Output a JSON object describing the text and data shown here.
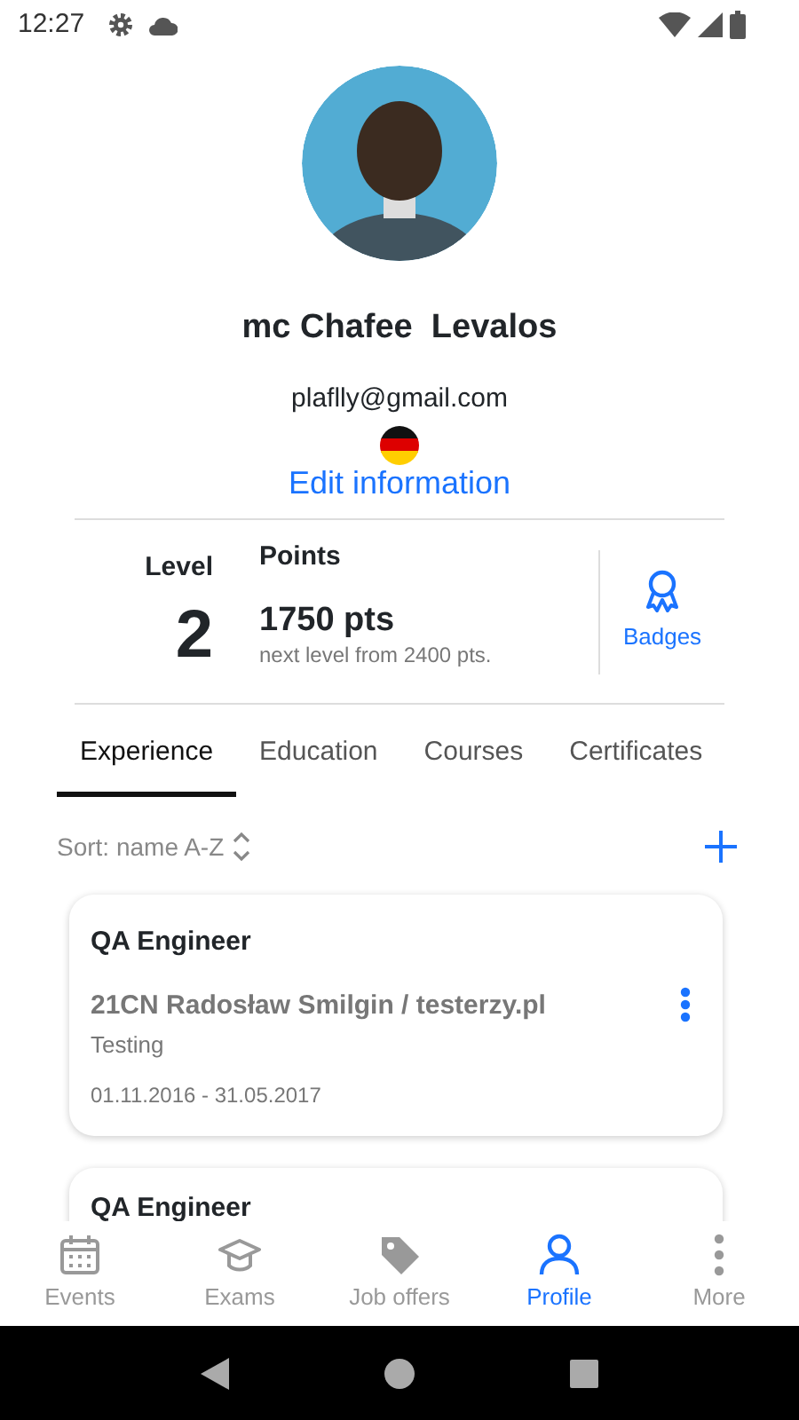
{
  "status_bar": {
    "time": "12:27"
  },
  "profile": {
    "name": "mc Chafee  Levalos",
    "email": "plaflly@gmail.com",
    "edit_link": "Edit information"
  },
  "stats": {
    "level_label": "Level",
    "level": "2",
    "points_label": "Points",
    "points": "1750 pts",
    "next_level": "next level from 2400 pts.",
    "badges": "Badges"
  },
  "tabs": [
    {
      "label": "Experience",
      "selected": true
    },
    {
      "label": "Education",
      "selected": false
    },
    {
      "label": "Courses",
      "selected": false
    },
    {
      "label": "Certificates",
      "selected": false
    }
  ],
  "sort": {
    "label": "Sort: name A-Z"
  },
  "experience": [
    {
      "title": "QA Engineer",
      "company": "21CN Radosław Smilgin / testerzy.pl",
      "field": "Testing",
      "dates": "01.11.2016 - 31.05.2017"
    },
    {
      "title": "QA Engineer"
    }
  ],
  "bottom_nav": [
    {
      "label": "Events",
      "selected": false
    },
    {
      "label": "Exams",
      "selected": false
    },
    {
      "label": "Job offers",
      "selected": false
    },
    {
      "label": "Profile",
      "selected": true
    },
    {
      "label": "More",
      "selected": false
    }
  ]
}
